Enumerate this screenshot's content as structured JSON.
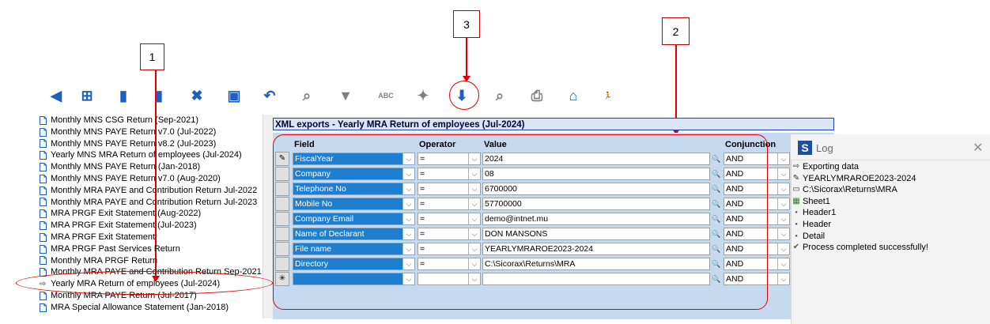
{
  "callouts": {
    "one": "1",
    "two": "2",
    "three": "3"
  },
  "toolbar": {
    "buttons": [
      {
        "name": "back-arrow-icon",
        "glyph": "◀"
      },
      {
        "name": "tree-icon",
        "glyph": "⊞"
      },
      {
        "name": "new-document-icon",
        "glyph": "▮"
      },
      {
        "name": "copy-document-icon",
        "glyph": "▮"
      },
      {
        "name": "delete-document-icon",
        "glyph": "✖"
      },
      {
        "name": "save-icon",
        "glyph": "▣"
      },
      {
        "name": "undo-icon",
        "glyph": "↶"
      },
      {
        "name": "search-document-icon",
        "glyph": "⌕"
      },
      {
        "name": "filter-icon",
        "glyph": "▼"
      },
      {
        "name": "abc-icon",
        "glyph": "ABC"
      },
      {
        "name": "magic-wand-icon",
        "glyph": "✦"
      },
      {
        "name": "export-icon",
        "glyph": "⬇"
      },
      {
        "name": "preview-icon",
        "glyph": "⌕"
      },
      {
        "name": "print-icon",
        "glyph": "⎙"
      },
      {
        "name": "home-icon",
        "glyph": "⌂"
      },
      {
        "name": "exit-runner-icon",
        "glyph": "🏃"
      }
    ]
  },
  "sidebar": {
    "items": [
      {
        "label": "Monthly MNS CSG Return (Sep-2021)",
        "selected": false
      },
      {
        "label": "Monthly MNS PAYE Return v7.0 (Jul-2022)",
        "selected": false
      },
      {
        "label": "Monthly MNS PAYE Return v8.2 (Jul-2023)",
        "selected": false
      },
      {
        "label": "Yearly MNS MRA Return of employees (Jul-2024)",
        "selected": false
      },
      {
        "label": "Monthly MNS PAYE Return (Jan-2018)",
        "selected": false
      },
      {
        "label": "Monthly MNS PAYE Return v7.0 (Aug-2020)",
        "selected": false
      },
      {
        "label": "Monthly MRA PAYE and Contribution Return Jul-2022",
        "selected": false
      },
      {
        "label": "Monthly MRA PAYE and Contribution Return Jul-2023",
        "selected": false
      },
      {
        "label": "MRA PRGF Exit Statement (Aug-2022)",
        "selected": false
      },
      {
        "label": "MRA PRGF Exit Statement (Jul-2023)",
        "selected": false
      },
      {
        "label": "MRA PRGF Exit Statement",
        "selected": false
      },
      {
        "label": "MRA PRGF Past Services Return",
        "selected": false
      },
      {
        "label": "Monthly MRA PRGF Return",
        "selected": false
      },
      {
        "label": "Monthly MRA PAYE and Contribution Return Sep-2021",
        "selected": false
      },
      {
        "label": "Yearly MRA Return of employees (Jul-2024)",
        "selected": true
      },
      {
        "label": "Monthly MRA PAYE Return (Jul-2017)",
        "selected": false
      },
      {
        "label": "MRA Special Allowance Statement (Jan-2018)",
        "selected": false
      }
    ]
  },
  "main": {
    "title": "XML exports - Yearly MRA Return of employees (Jul-2024)",
    "headers": {
      "field": "Field",
      "operator": "Operator",
      "value": "Value",
      "conjunction": "Conjunction"
    },
    "rows": [
      {
        "marker": "✎",
        "field": "FiscalYear",
        "operator": "=",
        "value": "2024",
        "conjunction": "AND"
      },
      {
        "marker": "",
        "field": "Company",
        "operator": "=",
        "value": "08",
        "conjunction": "AND"
      },
      {
        "marker": "",
        "field": "Telephone No",
        "operator": "=",
        "value": "6700000",
        "conjunction": "AND"
      },
      {
        "marker": "",
        "field": "Mobile No",
        "operator": "=",
        "value": "57700000",
        "conjunction": "AND"
      },
      {
        "marker": "",
        "field": "Company Email",
        "operator": "=",
        "value": "demo@intnet.mu",
        "conjunction": "AND"
      },
      {
        "marker": "",
        "field": "Name of Declarant",
        "operator": "=",
        "value": "DON MANSONS",
        "conjunction": "AND"
      },
      {
        "marker": "",
        "field": "File name",
        "operator": "=",
        "value": "YEARLYMRAROE2023-2024",
        "conjunction": "AND"
      },
      {
        "marker": "",
        "field": "Directory",
        "operator": "=",
        "value": "C:\\Sicorax\\Returns\\MRA",
        "conjunction": "AND"
      },
      {
        "marker": "✳",
        "field": "",
        "operator": "",
        "value": "",
        "conjunction": "AND"
      }
    ]
  },
  "log": {
    "title": "Log",
    "close": "✕",
    "lines": [
      {
        "icon": "⇨",
        "text": "Exporting data"
      },
      {
        "icon": "✎",
        "text": "YEARLYMRAROE2023-2024"
      },
      {
        "icon": "▭",
        "text": "C:\\Sicorax\\Returns\\MRA"
      },
      {
        "icon": "▦",
        "text": "Sheet1"
      },
      {
        "icon": "●",
        "text": "Header1"
      },
      {
        "icon": "●",
        "text": "Header"
      },
      {
        "icon": "●",
        "text": "Detail"
      },
      {
        "icon": "✔",
        "text": "Process completed successfully!"
      }
    ]
  },
  "colors": {
    "accent": "#e00000",
    "field_bg": "#1e7fd0",
    "panel_bg": "#c5d9ef"
  }
}
